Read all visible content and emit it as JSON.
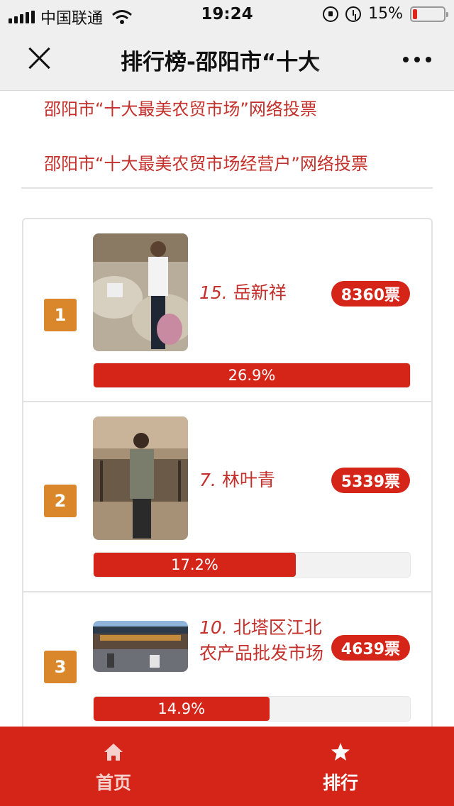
{
  "status_bar": {
    "carrier": "中国联通",
    "time": "19:24",
    "battery": "15%",
    "battery_level": 0.15
  },
  "nav": {
    "title": "排行榜-邵阳市“十大"
  },
  "links": [
    "邵阳市“十大最美农贸市场”网络投票",
    "邵阳市“十大最美农贸市场经营户”网络投票"
  ],
  "ranking": [
    {
      "rank": "1",
      "number": "15.",
      "name": "岳新祥",
      "votes": "8360票",
      "percent": "26.9%",
      "fill": 1.0
    },
    {
      "rank": "2",
      "number": "7.",
      "name": "林叶青",
      "votes": "5339票",
      "percent": "17.2%",
      "fill": 0.639
    },
    {
      "rank": "3",
      "number": "10.",
      "name": "北塔区江北农产品批发市场",
      "votes": "4639票",
      "percent": "14.9%",
      "fill": 0.555
    }
  ],
  "tabs": [
    {
      "label": "首页",
      "icon": "home-icon"
    },
    {
      "label": "排行",
      "icon": "star-icon"
    }
  ],
  "colors": {
    "accent": "#d52519",
    "link": "#c4302b",
    "badge": "#d9872a"
  }
}
